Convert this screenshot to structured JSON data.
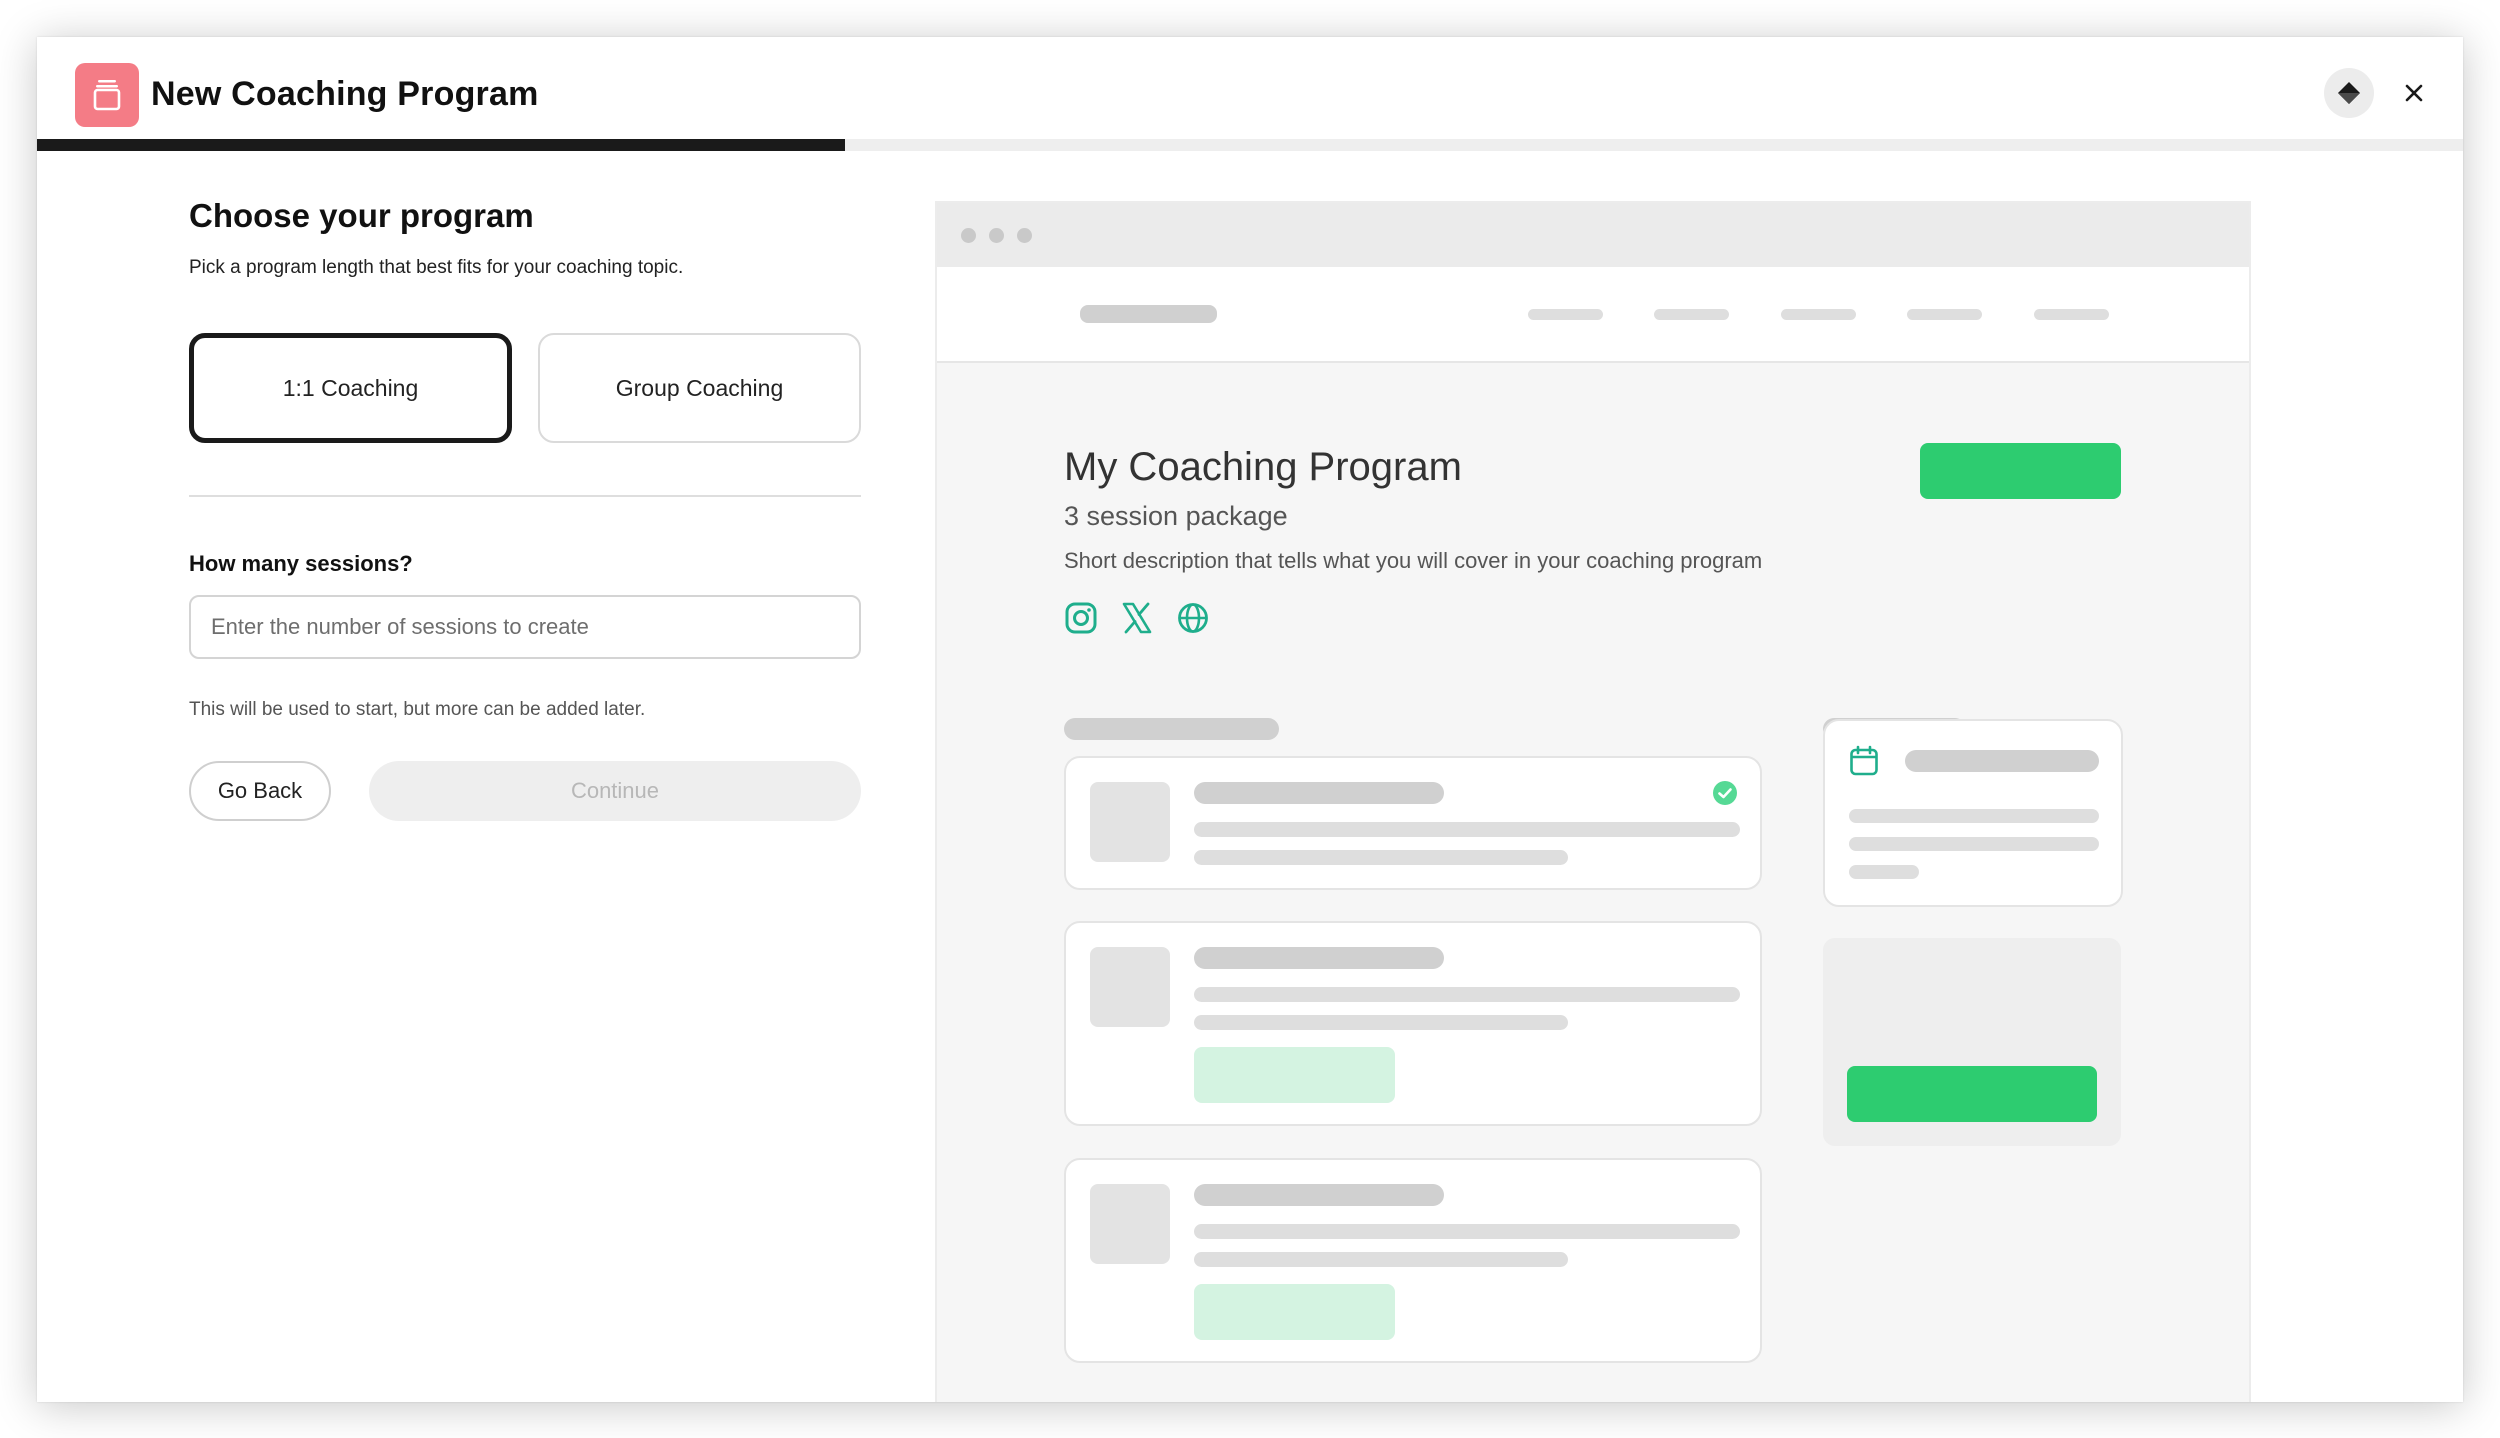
{
  "header": {
    "title": "New Coaching Program",
    "app_icon": "archive-box-icon",
    "theme_icon": "diamond-icon",
    "close_icon": "close-icon",
    "progress_fraction": 0.333
  },
  "form": {
    "heading": "Choose your program",
    "subheading": "Pick a program length that best fits for your coaching topic.",
    "options": [
      {
        "label": "1:1 Coaching",
        "selected": true
      },
      {
        "label": "Group Coaching",
        "selected": false
      }
    ],
    "sessions_label": "How many sessions?",
    "sessions_placeholder": "Enter the number of sessions to create",
    "sessions_value": "",
    "hint": "This will be used to start, but more can be added later.",
    "back_label": "Go Back",
    "continue_label": "Continue"
  },
  "preview": {
    "program_title": "My Coaching Program",
    "package": "3 session package",
    "description": "Short description that tells what you will cover in your coaching program",
    "social_icons": [
      "instagram-icon",
      "x-icon",
      "globe-icon"
    ],
    "accent_color": "#2dcc70",
    "icon_color": "#1fae8c"
  }
}
